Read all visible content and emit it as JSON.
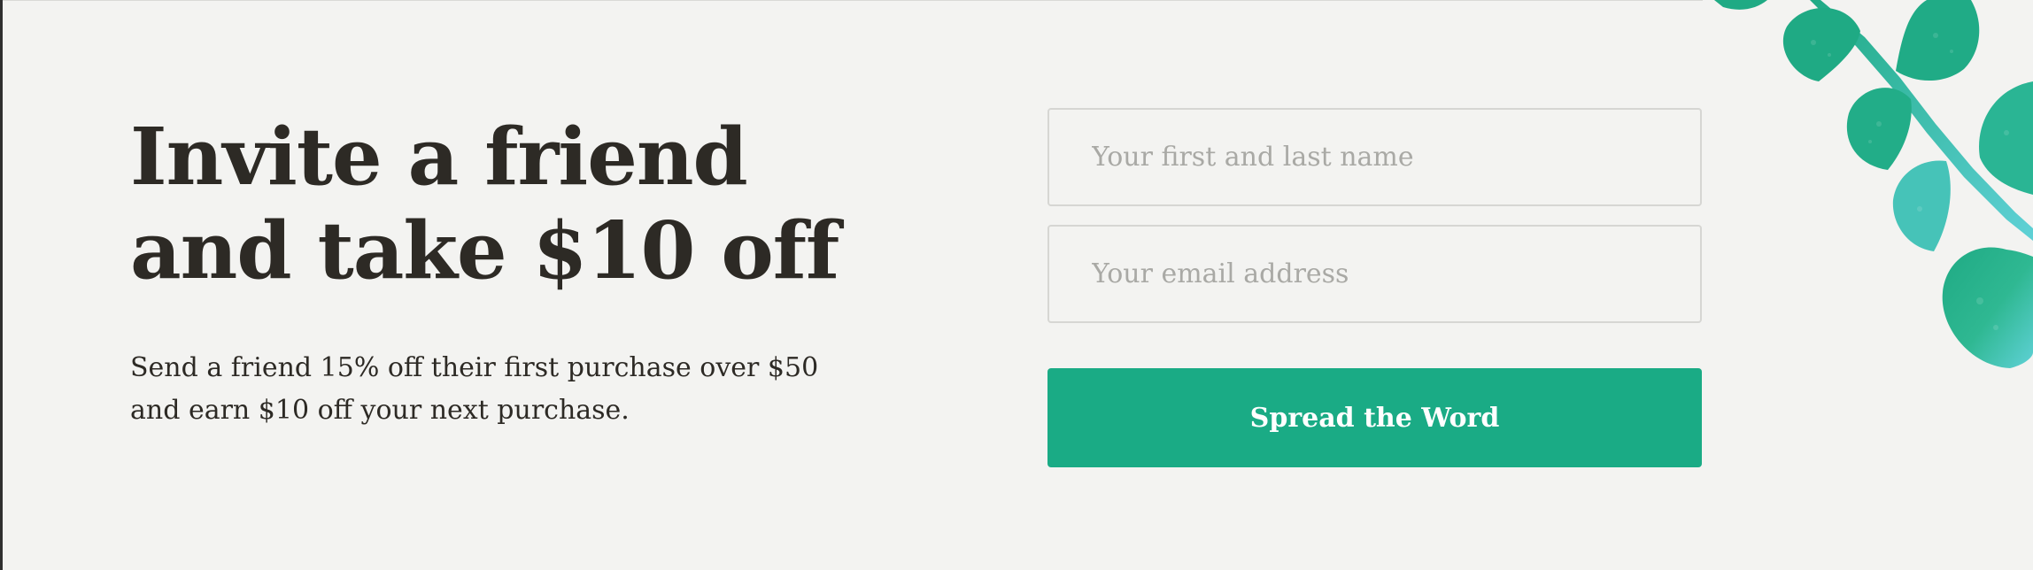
{
  "promo": {
    "headline_line1": "Invite a friend",
    "headline_line2": "and take $10 off",
    "description": "Send a friend 15% off their first purchase over $50 and earn $10 off your next purchase."
  },
  "form": {
    "name_placeholder": "Your first and last name",
    "name_value": "",
    "email_placeholder": "Your email address",
    "email_value": "",
    "submit_label": "Spread the Word"
  },
  "decoration": {
    "icon": "eucalyptus-leaves-illustration",
    "colors": [
      "#1faa84",
      "#5fd1d6"
    ]
  },
  "theme": {
    "background": "#f3f3f1",
    "text": "#2d2a25",
    "accent": "#1aab85"
  }
}
